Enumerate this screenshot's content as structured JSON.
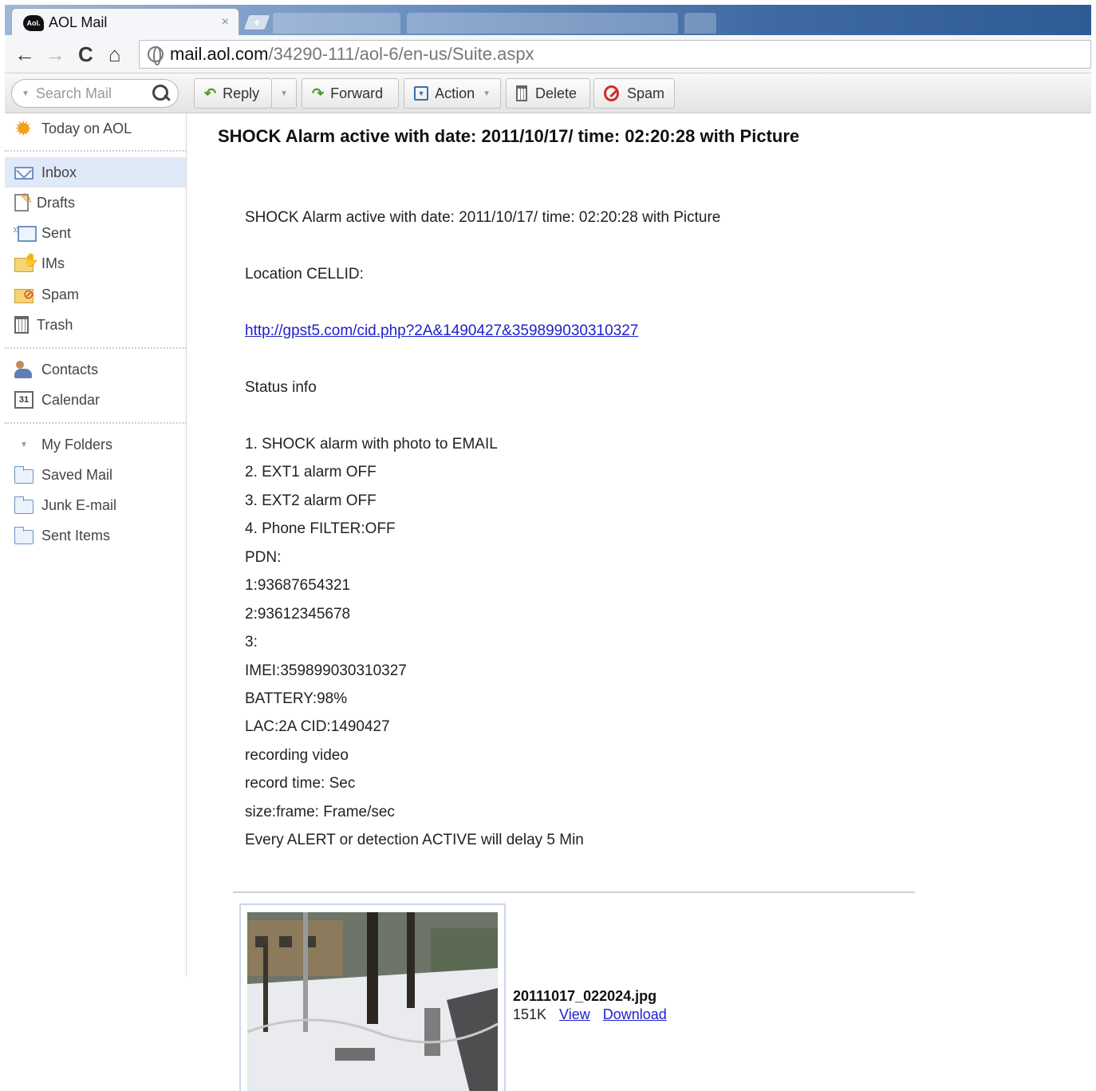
{
  "browser": {
    "tab_title": "AOL Mail",
    "tab_logo": "Aol.",
    "tab_close": "×",
    "new_tab": "+",
    "url_host": "mail.aol.com",
    "url_path": "/34290-111/aol-6/en-us/Suite.aspx",
    "back_icon": "←",
    "forward_icon": "→",
    "reload_icon": "C",
    "home_icon": "⌂"
  },
  "toolbar": {
    "search_placeholder": "Search Mail",
    "reply_label": "Reply",
    "forward_label": "Forward",
    "action_label": "Action",
    "delete_label": "Delete",
    "spam_label": "Spam"
  },
  "sidebar": {
    "today": "Today on AOL",
    "inbox": "Inbox",
    "drafts": "Drafts",
    "sent": "Sent",
    "ims": "IMs",
    "spam": "Spam",
    "trash": "Trash",
    "contacts": "Contacts",
    "calendar": "Calendar",
    "calendar_day": "31",
    "my_folders": "My Folders",
    "folders": [
      "Saved Mail",
      "Junk E-mail",
      "Sent Items"
    ]
  },
  "message": {
    "subject": "SHOCK Alarm active with date: 2011/10/17/ time: 02:20:28 with Picture",
    "intro": "SHOCK Alarm active with date: 2011/10/17/ time: 02:20:28 with Picture",
    "location": "Location CELLID:",
    "link": "http://gpst5.com/cid.php?2A&1490427&359899030310327",
    "status_heading": "Status info",
    "status_lines": [
      "1. SHOCK alarm  with photo to EMAIL",
      "2. EXT1 alarm OFF",
      "3. EXT2 alarm OFF",
      "4. Phone FILTER:OFF",
      "PDN:",
      "1:93687654321",
      "2:93612345678",
      "3:",
      "IMEI:359899030310327",
      "BATTERY:98%",
      "LAC:2A CID:1490427",
      "recording video",
      "record time: Sec",
      "size:frame:  Frame/sec",
      "Every ALERT or detection ACTIVE will delay  5 Min"
    ]
  },
  "attachment": {
    "filename": "20111017_022024.jpg",
    "size": "151K",
    "view_label": "View",
    "download_label": "Download"
  }
}
